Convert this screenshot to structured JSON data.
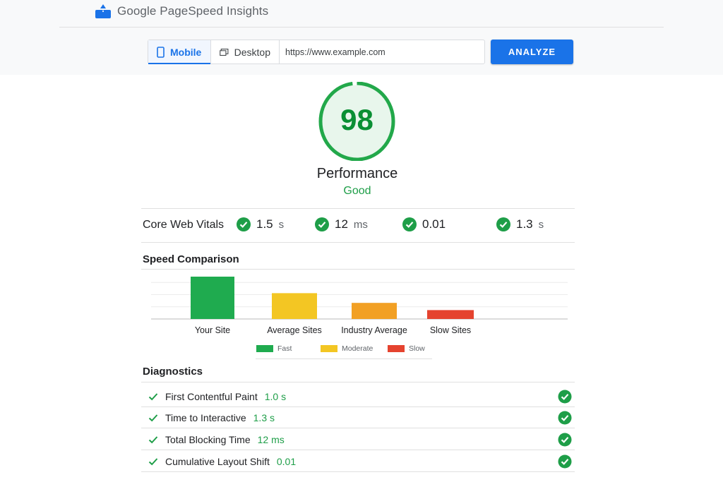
{
  "header": {
    "brand_google": "Google",
    "brand_product": "PageSpeed Insights",
    "logo_icon": "pagespeed-logo-icon"
  },
  "search": {
    "tabs": [
      {
        "label": "Mobile",
        "icon": "mobile-icon",
        "active": true
      },
      {
        "label": "Desktop",
        "icon": "desktop-icon",
        "active": false
      }
    ],
    "url_value": "https://www.example.com",
    "analyze_label": "ANALYZE"
  },
  "score": {
    "value": "98",
    "title": "Performance",
    "rating": "Good",
    "fraction": 0.98
  },
  "core_web_vitals": {
    "label": "Core Web Vitals",
    "metrics": [
      {
        "value": "1.5",
        "unit": "s"
      },
      {
        "value": "12",
        "unit": "ms"
      },
      {
        "value": "0.01",
        "unit": ""
      },
      {
        "value": "1.3",
        "unit": "s"
      }
    ]
  },
  "speed_comparison": {
    "title": "Speed Comparison"
  },
  "chart_data": {
    "type": "bar",
    "categories": [
      "Your Site",
      "Average Sites",
      "Industry Average",
      "Slow Sites"
    ],
    "values": [
      100,
      61,
      38,
      21
    ],
    "ylim": [
      0,
      100
    ],
    "grid": true,
    "colors": [
      "#1fab4f",
      "#f3c623",
      "#f2a024",
      "#e5432f"
    ],
    "legend": [
      {
        "label": "Fast",
        "color": "#1fab4f"
      },
      {
        "label": "Moderate",
        "color": "#f3c623"
      },
      {
        "label": "Slow",
        "color": "#e5432f"
      }
    ],
    "legend_position": "bottom"
  },
  "diagnostics": {
    "title": "Diagnostics",
    "items": [
      {
        "name": "First Contentful Paint",
        "value": "1.0 s"
      },
      {
        "name": "Time to Interactive",
        "value": "1.3 s"
      },
      {
        "name": "Total Blocking Time",
        "value": "12 ms"
      },
      {
        "name": "Cumulative Layout Shift",
        "value": "0.01"
      }
    ]
  },
  "colors": {
    "accent": "#1a73e8",
    "good": "#1e9e48",
    "score_ring": "#22a84a",
    "score_fill": "#e8f6ec"
  }
}
